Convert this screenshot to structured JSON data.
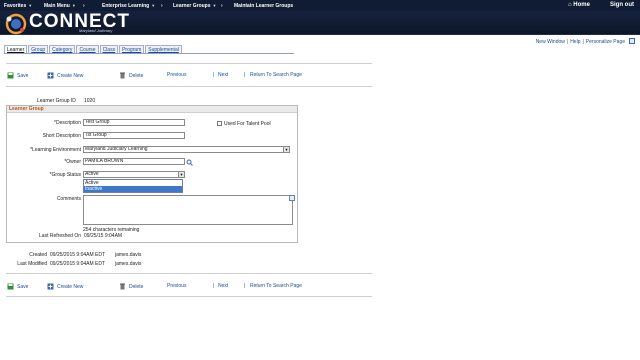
{
  "topbar": {
    "favorites": "Favorites",
    "main_menu": "Main Menu",
    "enterprise_learning": "Enterprise Learning",
    "learner_groups": "Learner Groups",
    "breadcrumb_current": "Maintain Learner Groups",
    "home": "Home",
    "sign_out": "Sign out"
  },
  "banner": {
    "logo_text": "CONNECT",
    "logo_sub": "Maryland Judiciary"
  },
  "toplinks": {
    "new_window": "New Window",
    "help": "Help",
    "personalize": "Personalize Page",
    "sep": "|"
  },
  "tabs": [
    "Learner",
    "Group",
    "Category",
    "Course",
    "Class",
    "Program",
    "Supplemental"
  ],
  "actions": {
    "save": "Save",
    "create_new": "Create New",
    "delete": "Delete",
    "previous": "Previous",
    "next": "Next",
    "return": "Return To Search Page"
  },
  "form": {
    "learner_group_id_label": "Learner Group ID",
    "learner_group_id_value": "1020",
    "section_title": "Learner Group",
    "description_label": "*Description",
    "description_value": "Test Group",
    "short_description_label": "Short Description",
    "short_description_value": "Tst Group",
    "talent_pool_label": "Used For Talent Pool",
    "learning_env_label": "*Learning Environment",
    "learning_env_value": "Maryland Judiciary Learning",
    "owner_label": "*Owner",
    "owner_value": "PAMILA BROWN",
    "group_status_label": "*Group Status",
    "group_status_value": "Active",
    "group_status_options": [
      "Active",
      "Inactive"
    ],
    "comments_label": "Comments",
    "chars_remaining": "254 characters remaining",
    "last_refreshed_label": "Last Refreshed On",
    "last_refreshed_value": "09/25/15  9:04AM"
  },
  "audit": {
    "created_label": "Created",
    "created_value": "09/25/2015  9:04AM EDT",
    "created_by": "james.davis",
    "modified_label": "Last Modified",
    "modified_value": "09/25/2015  9:04AM EDT",
    "modified_by": "james.davis"
  },
  "colors": {
    "topbar": "#101c33",
    "link": "#1b4a9a",
    "section_title": "#b8591a",
    "highlight": "#3d78c9"
  }
}
